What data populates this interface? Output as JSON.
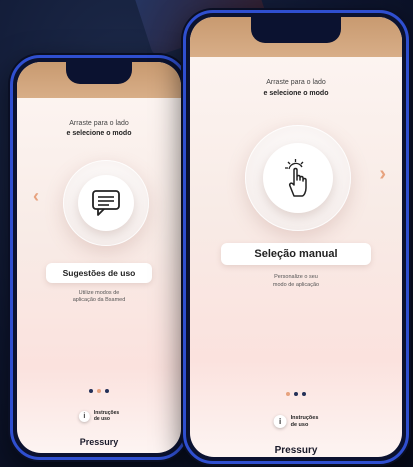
{
  "left_phone": {
    "instruction_line1": "Arraste para o lado",
    "instruction_line2": "e selecione o modo",
    "mode_label": "Sugestões de uso",
    "mode_description_line1": "Utilize modos de",
    "mode_description_line2": "aplicação da Bsamed",
    "help_line1": "Instruções",
    "help_line2": "de uso",
    "help_icon_glyph": "i",
    "brand": "Pressury",
    "prev_arrow": "‹",
    "icon": "chat-icon"
  },
  "right_phone": {
    "instruction_line1": "Arraste para o lado",
    "instruction_line2": "e selecione o modo",
    "mode_label": "Seleção manual",
    "mode_description_line1": "Personalize o seu",
    "mode_description_line2": "modo de aplicação",
    "help_line1": "Instruções",
    "help_line2": "de uso",
    "help_icon_glyph": "i",
    "brand": "Pressury",
    "next_arrow": "›",
    "icon": "tap-hand-icon"
  },
  "colors": {
    "accent": "#e7a27e",
    "frame": "#2f4fd0",
    "dot_inactive": "#243058"
  },
  "pagination": {
    "left_active_index": 1,
    "right_active_index": 0,
    "count": 3
  }
}
